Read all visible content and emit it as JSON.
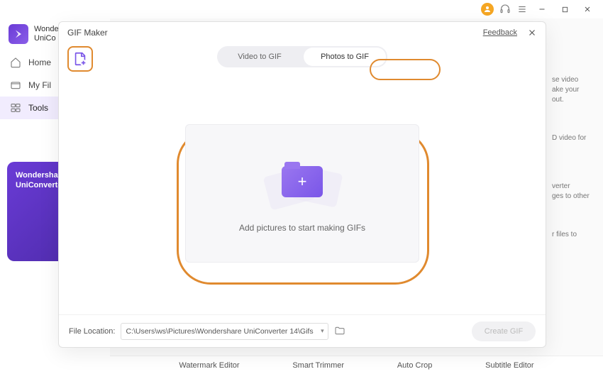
{
  "titlebar": {
    "feedback_label": "Feedback"
  },
  "brand": {
    "line1": "Wonde",
    "line2": "UniCo"
  },
  "sidebar": {
    "items": [
      {
        "label": "Home"
      },
      {
        "label": "My Fil"
      },
      {
        "label": "Tools"
      }
    ]
  },
  "promo": {
    "line1": "Wondersha",
    "line2": "UniConverter"
  },
  "bg_cards": [
    {
      "text": "se video\nake your\nout."
    },
    {
      "text": "D video for"
    },
    {
      "text": "verter\nges to other"
    },
    {
      "text": "r files to"
    }
  ],
  "bottom_tools": [
    "Watermark Editor",
    "Smart Trimmer",
    "Auto Crop",
    "Subtitle Editor"
  ],
  "modal": {
    "title": "GIF Maker",
    "feedback": "Feedback",
    "tabs": {
      "video": "Video to GIF",
      "photos": "Photos to GIF"
    },
    "dropzone_text": "Add pictures to start making GIFs",
    "footer": {
      "location_label": "File Location:",
      "path": "C:\\Users\\ws\\Pictures\\Wondershare UniConverter 14\\Gifs",
      "create_label": "Create GIF"
    }
  }
}
